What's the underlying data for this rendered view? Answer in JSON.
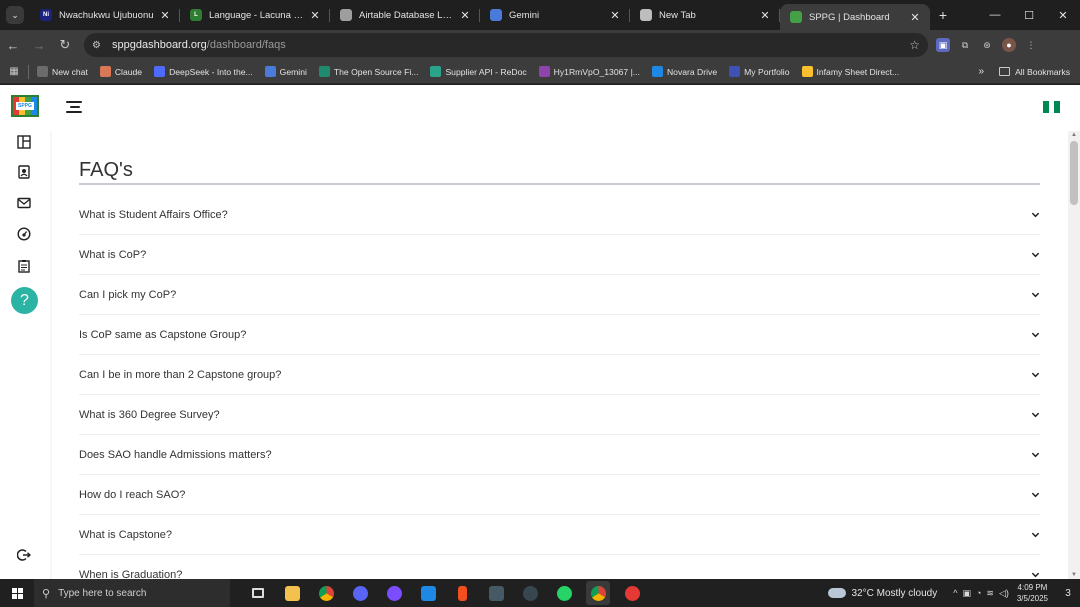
{
  "browser": {
    "tabs": [
      {
        "title": "Nwachukwu Ujubuonu",
        "favicon": "Ni",
        "color": "#1a237e"
      },
      {
        "title": "Language - Lacuna Fund",
        "favicon": "L",
        "color": "#2e7d32"
      },
      {
        "title": "Airtable Database Limitatio",
        "favicon": "",
        "color": "#9e9e9e"
      },
      {
        "title": "Gemini",
        "favicon": "",
        "color": "#4a7bd9"
      },
      {
        "title": "New Tab",
        "favicon": "",
        "color": "#bdbdbd"
      },
      {
        "title": "SPPG | Dashboard",
        "favicon": "",
        "color": "#43a047",
        "active": true
      }
    ],
    "url_host": "sppgdashboard.org",
    "url_path": "/dashboard/faqs",
    "bookmarks": [
      {
        "label": "New chat",
        "color": "#6b6b6b"
      },
      {
        "label": "Claude",
        "color": "#d97757"
      },
      {
        "label": "DeepSeek - Into the...",
        "color": "#4d6bfe"
      },
      {
        "label": "Gemini",
        "color": "#4a7bd9"
      },
      {
        "label": "The Open Source Fi...",
        "color": "#1f8a70"
      },
      {
        "label": "Supplier API - ReDoc",
        "color": "#2aa38b"
      },
      {
        "label": "Hy1RmVpO_13067 |...",
        "color": "#8e44ad"
      },
      {
        "label": "Novara Drive",
        "color": "#1e88e5"
      },
      {
        "label": "My Portfolio",
        "color": "#3f51b5"
      },
      {
        "label": "Infamy Sheet Direct...",
        "color": "#fbc02d"
      }
    ],
    "all_bookmarks": "All Bookmarks"
  },
  "app": {
    "logo_text": "SPPG",
    "page_title": "FAQ's",
    "faqs": [
      "What is Student Affairs Office?",
      "What is CoP?",
      "Can I pick my CoP?",
      "Is CoP same as Capstone Group?",
      "Can I be in more than 2 Capstone group?",
      "What is 360 Degree Survey?",
      "Does SAO handle Admissions matters?",
      "How do I reach SAO?",
      "What is Capstone?",
      "When is Graduation?"
    ],
    "help_symbol": "?"
  },
  "taskbar": {
    "search_placeholder": "Type here to search",
    "weather": "32°C  Mostly cloudy",
    "time": "4:09 PM",
    "date": "3/5/2025",
    "notification_count": "3"
  }
}
